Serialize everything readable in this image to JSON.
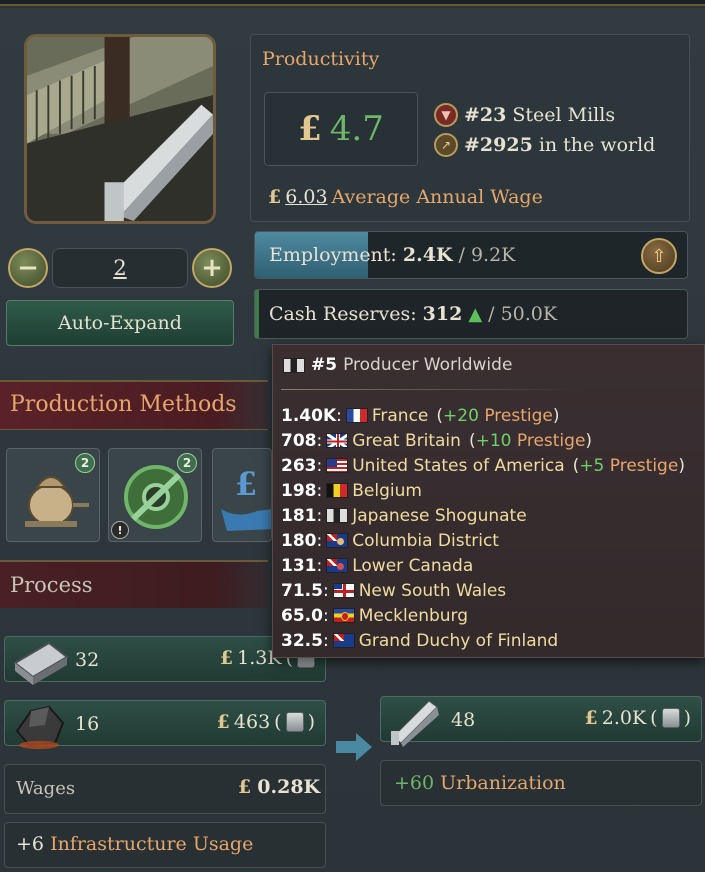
{
  "building": {
    "level": "2",
    "auto_expand_label": "Auto-Expand"
  },
  "productivity": {
    "title": "Productivity",
    "currency": "£",
    "value": "4.7",
    "rank_industry": "#23",
    "rank_industry_label": "Steel Mills",
    "rank_world": "#2925",
    "rank_world_label": "in the world",
    "wage_currency": "£",
    "wage_value": "6.03",
    "wage_label": "Average Annual Wage"
  },
  "employment": {
    "label": "Employment:",
    "current": "2.4K",
    "separator": "/",
    "max": "9.2K",
    "fill_fraction": 0.261
  },
  "cash": {
    "label": "Cash Reserves:",
    "current": "312",
    "separator": "/",
    "max": "50.0K"
  },
  "production_methods": {
    "title": "Production Methods",
    "slots": [
      {
        "icon": "furnace-icon",
        "badge": "2"
      },
      {
        "icon": "no-automation-gear-icon",
        "badge": "2",
        "warning": "!"
      },
      {
        "icon": "ownership-hand-icon"
      }
    ]
  },
  "process": {
    "title": "Process",
    "inputs": [
      {
        "icon": "iron-ingot-icon",
        "qty": "32",
        "currency": "£",
        "value": "1.3K",
        "open": "("
      },
      {
        "icon": "coal-icon",
        "qty": "16",
        "currency": "£",
        "value": "463",
        "open": "(",
        "close": ")"
      }
    ],
    "output": {
      "icon": "steel-beam-icon",
      "qty": "48",
      "currency": "£",
      "value": "2.0K",
      "open": "(",
      "close": ")"
    },
    "wages_label": "Wages",
    "wages_currency": "£",
    "wages_value": "0.28K",
    "infra_plus": "+6",
    "infra_label": "Infrastructure Usage",
    "urban_plus": "+60",
    "urban_label": "Urbanization"
  },
  "tooltip": {
    "rank": "#5",
    "rank_label": "Producer Worldwide",
    "rows": [
      {
        "amount": "1.40K",
        "colon": ":",
        "country": "France",
        "prestige_open": "(",
        "prestige": "+20",
        "prestige_label": "Prestige",
        "prestige_close": ")"
      },
      {
        "amount": "708",
        "colon": ":",
        "country": "Great Britain",
        "prestige_open": "(",
        "prestige": "+10",
        "prestige_label": "Prestige",
        "prestige_close": ")"
      },
      {
        "amount": "263",
        "colon": ":",
        "country": "United States of America",
        "prestige_open": "(",
        "prestige": "+5",
        "prestige_label": "Prestige",
        "prestige_close": ")"
      },
      {
        "amount": "198",
        "colon": ":",
        "country": "Belgium"
      },
      {
        "amount": "181",
        "colon": ":",
        "country": "Japanese Shogunate"
      },
      {
        "amount": "180",
        "colon": ":",
        "country": "Columbia District"
      },
      {
        "amount": "131",
        "colon": ":",
        "country": "Lower Canada"
      },
      {
        "amount": "71.5",
        "colon": ":",
        "country": "New South Wales"
      },
      {
        "amount": "65.0",
        "colon": ":",
        "country": "Mecklenburg"
      },
      {
        "amount": "32.5",
        "colon": ":",
        "country": "Grand Duchy of Finland"
      }
    ]
  },
  "colors": {
    "accent_orange": "#e6a66c",
    "positive_green": "#6fb56a",
    "currency_gold": "#e0c890",
    "header_red": "#5a2228"
  }
}
